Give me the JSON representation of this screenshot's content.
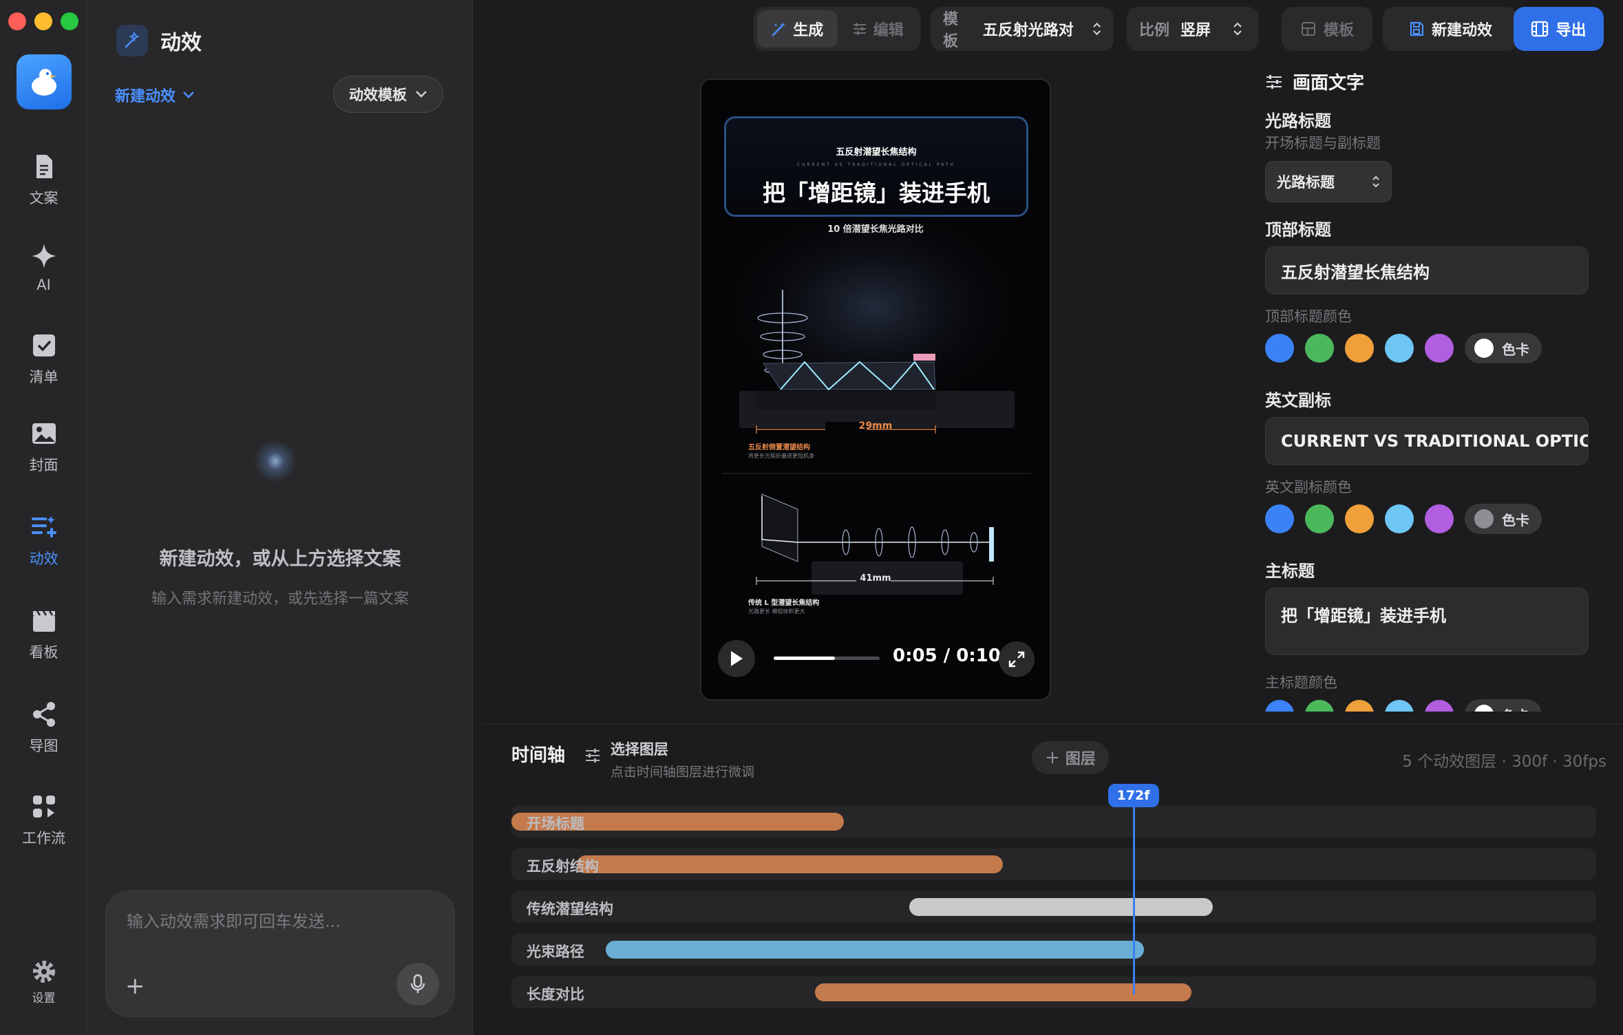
{
  "sidebar": {
    "items": [
      {
        "label": "文案",
        "icon": "document-icon"
      },
      {
        "label": "AI",
        "icon": "sparkle-icon"
      },
      {
        "label": "清单",
        "icon": "checklist-icon"
      },
      {
        "label": "封面",
        "icon": "image-icon"
      },
      {
        "label": "动效",
        "icon": "motion-icon",
        "active": true
      },
      {
        "label": "看板",
        "icon": "clapperboard-icon"
      },
      {
        "label": "导图",
        "icon": "share-icon"
      },
      {
        "label": "工作流",
        "icon": "workflow-icon"
      }
    ],
    "settings_label": "设置"
  },
  "left_panel": {
    "title": "动效",
    "new_label": "新建动效",
    "template_button": "动效模板",
    "empty_title": "新建动效，或从上方选择文案",
    "empty_subtitle": "输入需求新建动效，或先选择一篇文案",
    "input_placeholder": "输入动效需求即可回车发送..."
  },
  "toolbar": {
    "generate": "生成",
    "edit": "编辑",
    "template_label": "模板",
    "template_value": "五反射光路对",
    "ratio_label": "比例",
    "ratio_value": "竖屏",
    "layout": "模板",
    "new_effect": "新建动效",
    "export": "导出"
  },
  "preview": {
    "top_title": "五反射潜望长焦结构",
    "en_subtitle": "CURRENT VS TRADITIONAL OPTICAL PATH",
    "main_title": "把「增距镜」装进手机",
    "caption": "10 倍潜望长焦光路对比",
    "dim1": "29mm",
    "label1": "五反射倒置潜望结构",
    "label1_sub": "将更长光程折叠进更短机身",
    "dim2": "41mm",
    "label2": "传统 L 型潜望长焦结构",
    "label2_sub": "光路更长 模组体积更大",
    "time": "0:05 / 0:10",
    "progress": 0.58
  },
  "right_panel": {
    "title": "画面文字",
    "section": "光路标题",
    "section_sub": "开场标题与副标题",
    "select_value": "光路标题",
    "top_title_label": "顶部标题",
    "top_title_value": "五反射潜望长焦结构",
    "top_color_label": "顶部标题颜色",
    "card_label": "色卡",
    "en_label": "英文副标",
    "en_value": "CURRENT VS TRADITIONAL OPTICA",
    "en_color_label": "英文副标颜色",
    "main_label": "主标题",
    "main_value": "把「增距镜」装进手机",
    "main_color_label": "主标题颜色",
    "swatches": [
      "#3b82f6",
      "#4cb85c",
      "#f0a03a",
      "#6ec6f5",
      "#b15ee0"
    ]
  },
  "timeline": {
    "title": "时间轴",
    "select_title": "选择图层",
    "select_sub": "点击时间轴图层进行微调",
    "add_layer": "图层",
    "meta": "5 个动效图层 · 300f · 30fps",
    "playhead": "172f",
    "total_frames": 300,
    "current_frame": 172,
    "tracks": [
      {
        "label": "开场标题",
        "start": 0,
        "end": 92,
        "color": "#c47a4c"
      },
      {
        "label": "五反射结构",
        "start": 18,
        "end": 136,
        "color": "#c47a4c"
      },
      {
        "label": "传统潜望结构",
        "start": 110,
        "end": 194,
        "color": "#c9c9cc"
      },
      {
        "label": "光束路径",
        "start": 26,
        "end": 175,
        "color": "#6aaed6"
      },
      {
        "label": "长度对比",
        "start": 84,
        "end": 188,
        "color": "#c47a4c"
      }
    ]
  }
}
